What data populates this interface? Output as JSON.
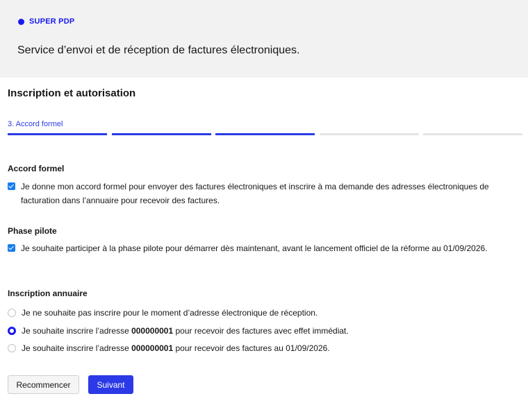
{
  "header": {
    "brand": "SUPER PDP",
    "tagline": "Service d’envoi et de réception de factures électroniques."
  },
  "page": {
    "title": "Inscription et autorisation",
    "step_label": "3. Accord formel",
    "steps": {
      "total": 5,
      "completed": 3
    }
  },
  "accord": {
    "title": "Accord formel",
    "checked": true,
    "text": "Je donne mon accord formel pour envoyer des factures électroniques et inscrire à ma demande des adresses électroniques de facturation dans l’annuaire pour recevoir des factures."
  },
  "pilot": {
    "title": "Phase pilote",
    "checked": true,
    "text": "Je souhaite participer à la phase pilote pour démarrer dès maintenant, avant le lancement officiel de la réforme au 01/09/2026."
  },
  "annuaire": {
    "title": "Inscription annuaire",
    "options": [
      {
        "selected": false,
        "text": "Je ne souhaite pas inscrire pour le moment d’adresse électronique de réception."
      },
      {
        "selected": true,
        "prefix": "Je souhaite inscrire l’adresse ",
        "address": "000000001",
        "suffix": " pour recevoir des factures avec effet immédiat."
      },
      {
        "selected": false,
        "prefix": "Je souhaite inscrire l’adresse ",
        "address": "000000001",
        "suffix": " pour recevoir des factures au 01/09/2026."
      }
    ]
  },
  "actions": {
    "restart_label": "Recommencer",
    "next_label": "Suivant"
  },
  "colors": {
    "accent": "#2b3ae6",
    "brand": "#1a1af0",
    "checkbox": "#1a7cf0",
    "header_bg": "#f2f2f2"
  }
}
